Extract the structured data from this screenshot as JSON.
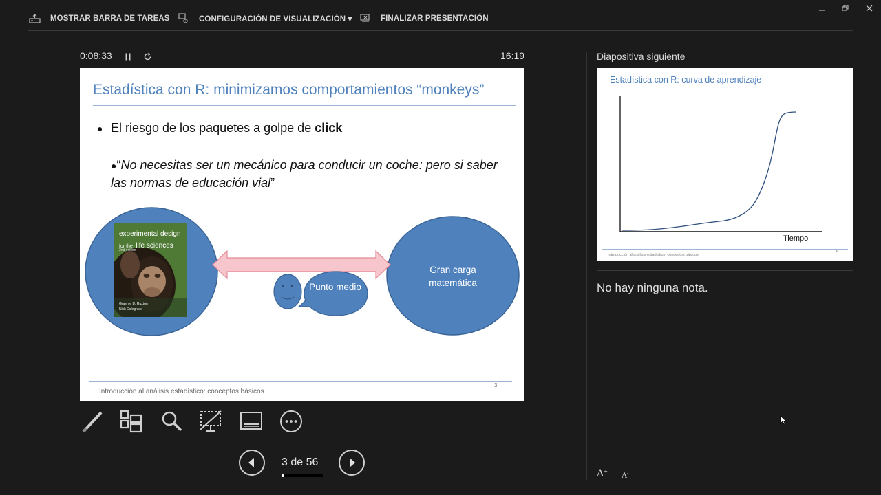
{
  "toolbar": {
    "show_taskbar": "MOSTRAR BARRA DE TAREAS",
    "display_settings": "CONFIGURACIÓN DE VISUALIZACIÓN ▾",
    "end_show": "FINALIZAR PRESENTACIÓN"
  },
  "timer": {
    "elapsed": "0:08:33",
    "clock": "16:19"
  },
  "slide": {
    "title": "Estadística con R: minimizamos comportamientos “monkeys”",
    "bullet1_prefix": "El riesgo de los paquetes a golpe de ",
    "bullet1_bold": "click",
    "bullet2_quote_open": "“",
    "bullet2_italic": "No necesitas ser un mecánico para conducir un coche: pero si saber las normas de educación vial",
    "bullet2_quote_close": "”",
    "book": {
      "line1": "experimental design",
      "line2_small": "for the",
      "line2_big": "life sciences",
      "edition": "2nd edition",
      "authors1": "Graeme D. Ruxton",
      "authors2": "Nick Colegrave"
    },
    "middle_bubble": "Punto medio",
    "right_circle": "Gran carga matemática",
    "footer": "Introducción al análisis estadístico: conceptos básicos",
    "page_number": "3"
  },
  "navigation": {
    "counter": "3 de 56",
    "progress_fraction": 0.054
  },
  "next_slide": {
    "label": "Diapositiva siguiente",
    "title": "Estadística con R: curva de aprendizaje",
    "x_axis_label": "Tiempo",
    "footer": "Introducción al análisis estadístico: conceptos básicos",
    "page_number": "4"
  },
  "notes": {
    "text": "No hay ninguna nota."
  },
  "icons": [
    "taskbar-icon",
    "display-settings-icon",
    "end-show-icon",
    "minimize-icon",
    "restore-icon",
    "close-icon",
    "pause-icon",
    "restart-icon",
    "pen-icon",
    "slides-grid-icon",
    "zoom-icon",
    "screen-off-icon",
    "subtitles-icon",
    "more-options-icon",
    "previous-icon",
    "next-icon",
    "font-increase-icon",
    "font-decrease-icon"
  ],
  "colors": {
    "accent_blue": "#4f81bd",
    "shape_blue": "#4f81bd",
    "arrow_pink": "#f6c6cc",
    "background": "#1b1b1b"
  }
}
